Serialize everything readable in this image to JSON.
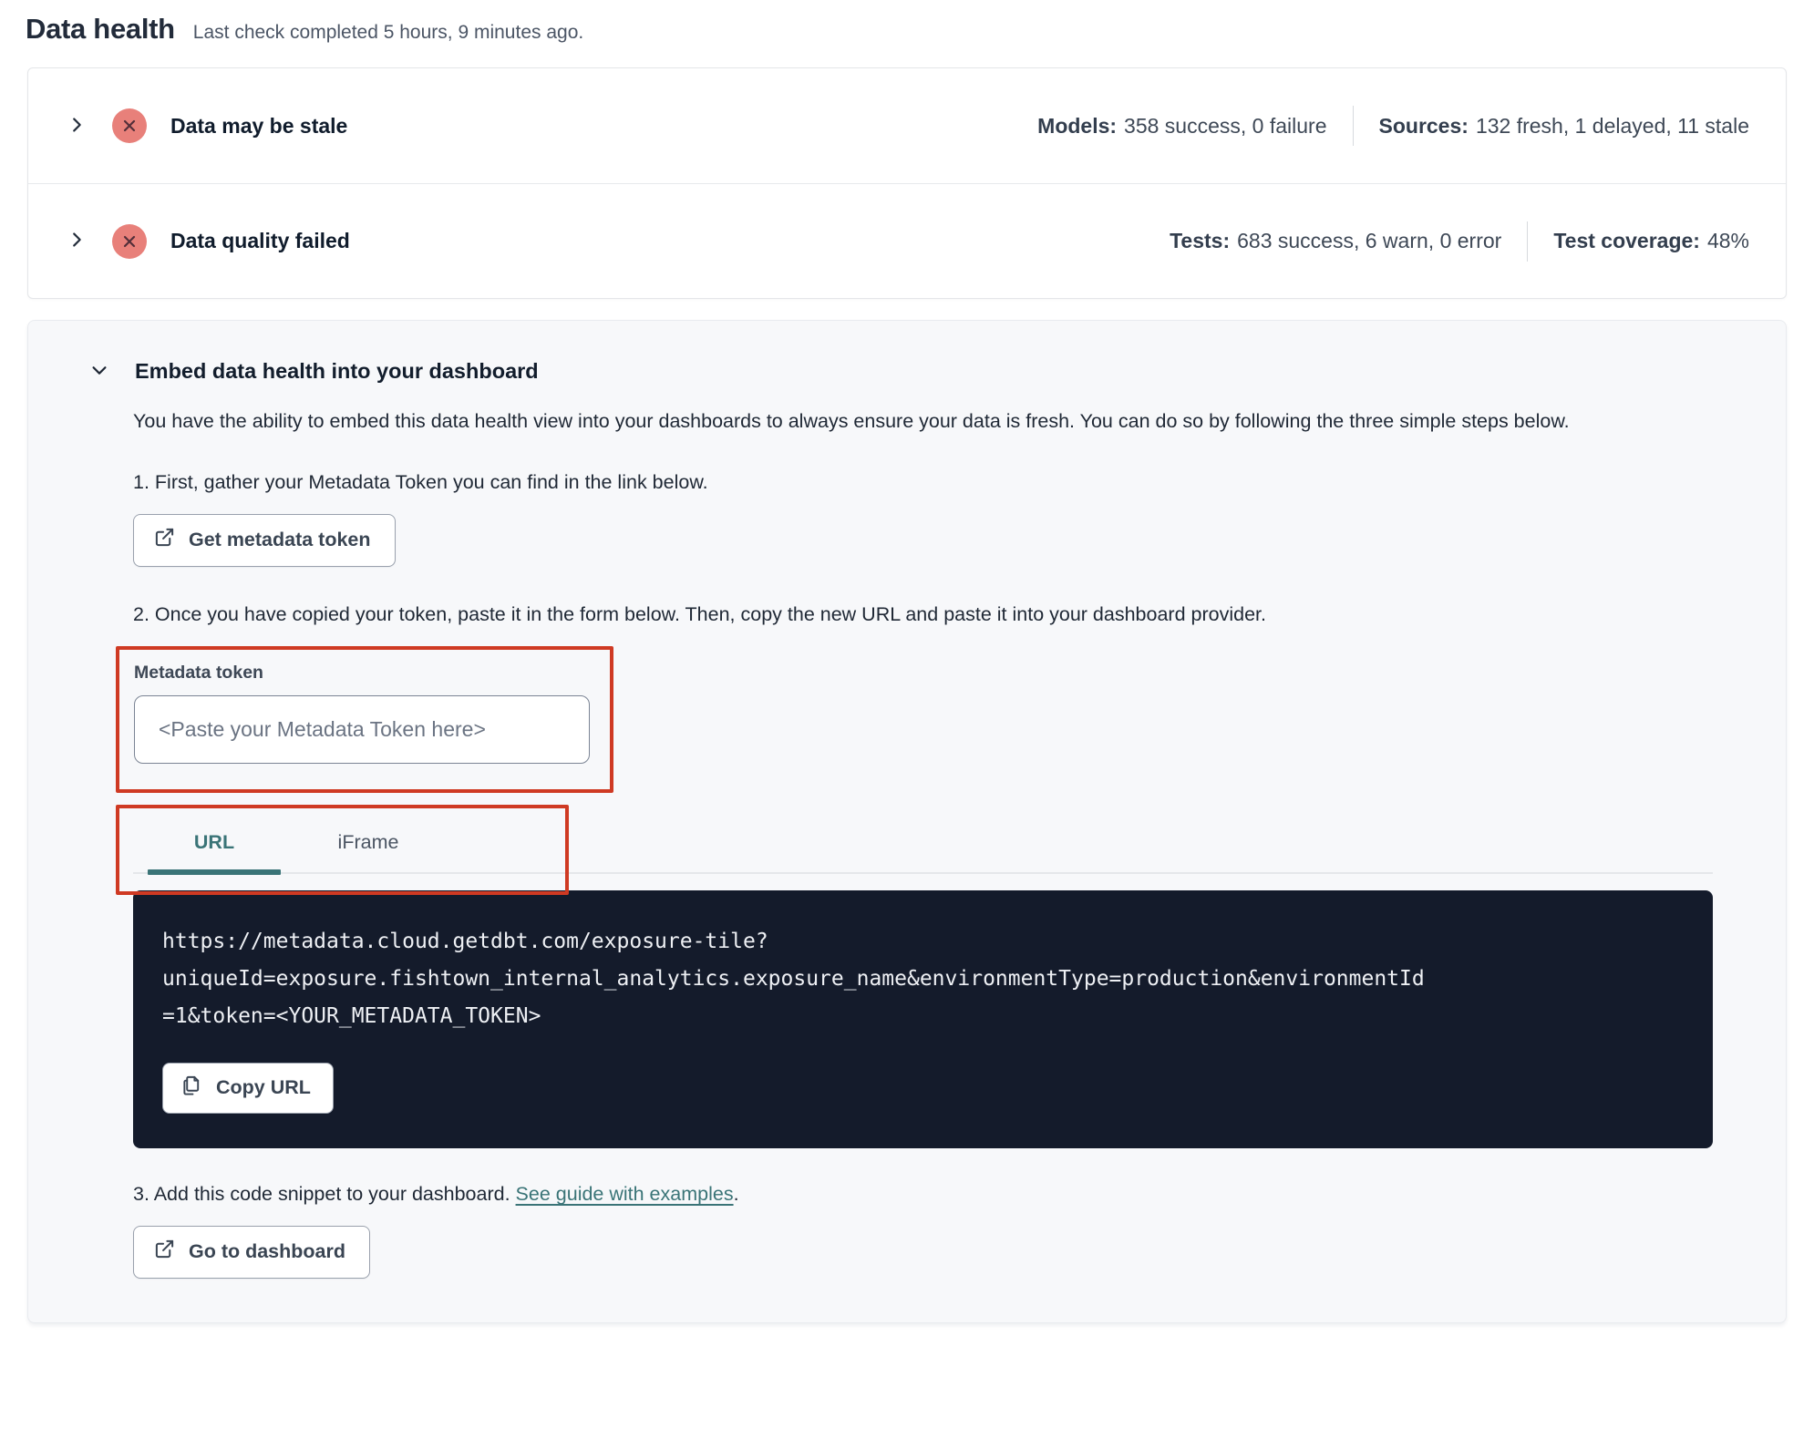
{
  "page": {
    "title": "Data health",
    "subtitle": "Last check completed 5 hours, 9 minutes ago."
  },
  "status_rows": [
    {
      "icon": "x-circle-icon",
      "label": "Data may be stale",
      "stats": [
        {
          "label": "Models:",
          "value": "358 success, 0 failure"
        },
        {
          "label": "Sources:",
          "value": "132 fresh, 1 delayed, 11 stale"
        }
      ]
    },
    {
      "icon": "x-circle-icon",
      "label": "Data quality failed",
      "stats": [
        {
          "label": "Tests:",
          "value": "683 success, 6 warn, 0 error"
        },
        {
          "label": "Test coverage:",
          "value": "48%"
        }
      ]
    }
  ],
  "embed": {
    "title": "Embed data health into your dashboard",
    "description": "You have the ability to embed this data health view into your dashboards to always ensure your data is fresh. You can do so by following the three simple steps below.",
    "step1": {
      "text": "1. First, gather your Metadata Token you can find in the link below.",
      "button_label": "Get metadata token",
      "button_icon": "external-link-icon"
    },
    "step2": {
      "text": "2. Once you have copied your token, paste it in the form below. Then, copy the new URL and paste it into your dashboard provider.",
      "token_label": "Metadata token",
      "token_value": "",
      "token_placeholder": "<Paste your Metadata Token here>",
      "tabs": [
        {
          "label": "URL",
          "active": true
        },
        {
          "label": "iFrame",
          "active": false
        }
      ],
      "code_url": "https://metadata.cloud.getdbt.com/exposure-tile?\nuniqueId=exposure.fishtown_internal_analytics.exposure_name&environmentType=production&environmentId\n=1&token=<YOUR_METADATA_TOKEN>",
      "copy_button_label": "Copy URL",
      "copy_button_icon": "copy-icon"
    },
    "step3": {
      "text_before_link": "3. Add this code snippet to your dashboard. ",
      "link_text": "See guide with examples",
      "text_after_link": ".",
      "button_label": "Go to dashboard",
      "button_icon": "external-link-icon"
    }
  },
  "colors": {
    "accent_teal": "#3a7477",
    "status_error_badge": "#e8807a",
    "status_error_glyph": "#532e39",
    "annotation_red": "#cf3a23",
    "code_background": "#141b2b",
    "section_background": "#f7f8fa",
    "border_gray": "#e4e6e9",
    "text_dark": "#1f2835"
  }
}
